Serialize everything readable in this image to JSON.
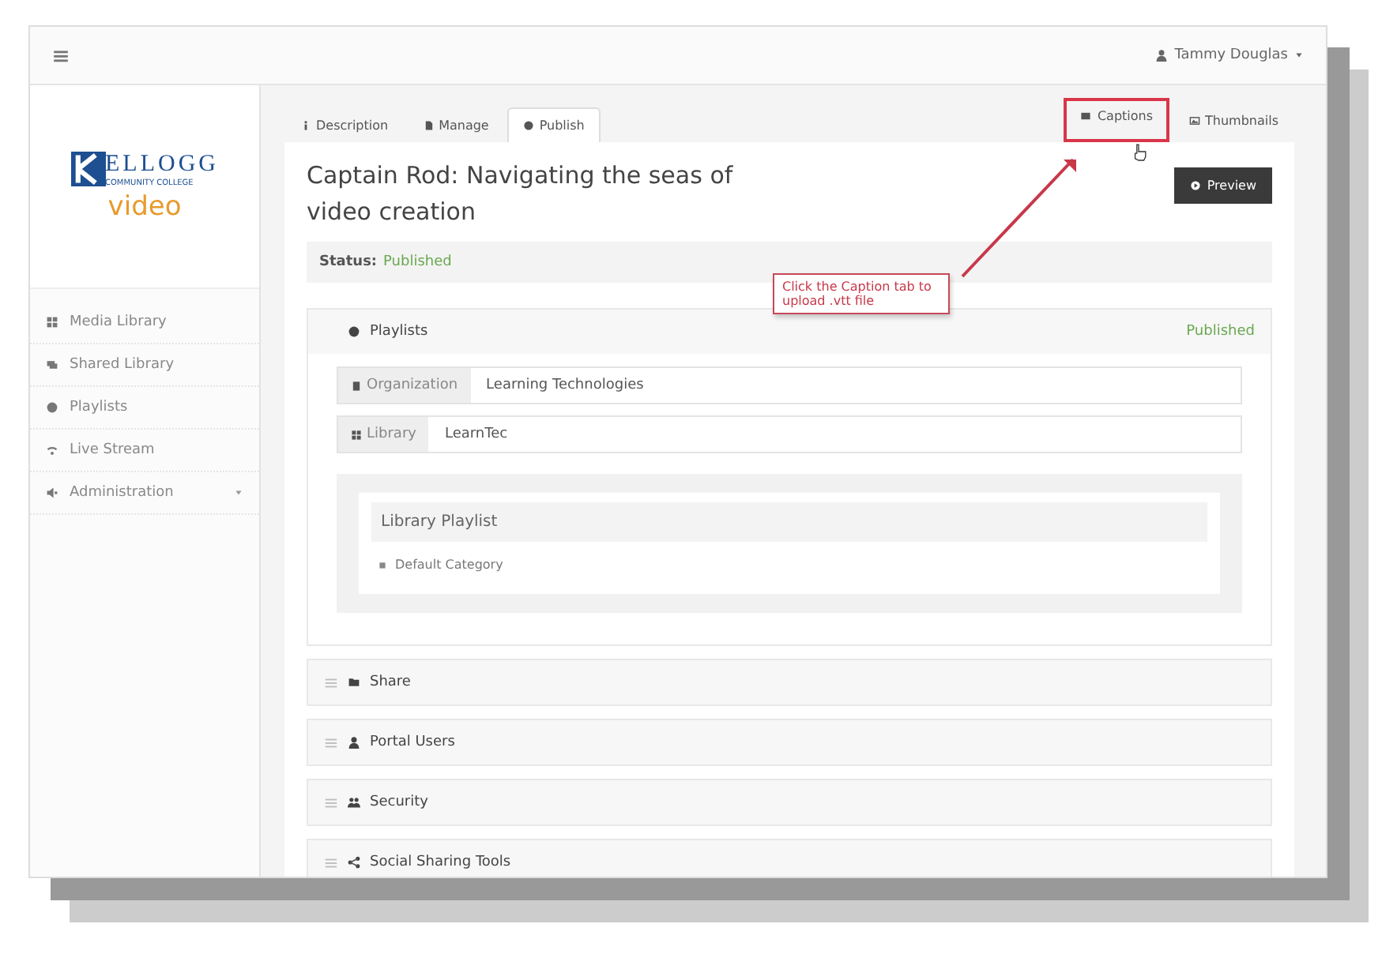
{
  "header": {
    "user": "Tammy Douglas"
  },
  "logo": {
    "title": "ELLOGG",
    "subtitle": "COMMUNITY COLLEGE",
    "product": "video"
  },
  "sidebar": {
    "items": [
      {
        "label": "Media Library",
        "kind": "link"
      },
      {
        "label": "Shared Library",
        "kind": "link"
      },
      {
        "label": "Playlists",
        "kind": "link"
      },
      {
        "label": "Live Stream",
        "kind": "link"
      },
      {
        "label": "Administration",
        "kind": "group"
      }
    ]
  },
  "tabs": [
    {
      "label": "Description",
      "selected": false
    },
    {
      "label": "Manage",
      "selected": false
    },
    {
      "label": "Publish",
      "selected": true
    }
  ],
  "side_tabs": [
    {
      "label": "Captions",
      "highlighted": true
    },
    {
      "label": "Thumbnails",
      "highlighted": false
    }
  ],
  "media": {
    "title": "Captain Rod: Navigating the seas of video creation",
    "button": "Preview",
    "status_label": "Status:",
    "status": "Published"
  },
  "callout": "Click the Caption tab to upload .vtt file",
  "sections": [
    {
      "title": "Playlists",
      "expanded": true,
      "state": "Published",
      "fields": [
        {
          "label": "Organization",
          "value": "Learning Technologies"
        },
        {
          "label": "Library",
          "value": "LearnTec"
        }
      ],
      "well": {
        "title": "Library Playlist",
        "items": [
          "Default Category"
        ]
      }
    },
    {
      "title": "Share",
      "expanded": false
    },
    {
      "title": "Portal Users",
      "expanded": false
    },
    {
      "title": "Security",
      "expanded": false
    },
    {
      "title": "Social Sharing Tools",
      "expanded": false
    }
  ]
}
